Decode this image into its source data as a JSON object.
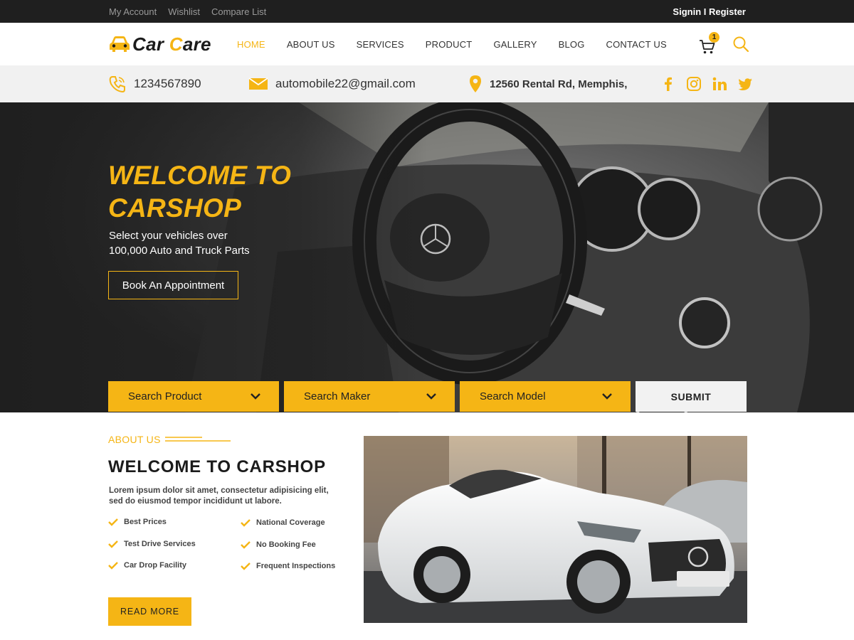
{
  "topbar": {
    "links": [
      "My Account",
      "Wishlist",
      "Compare List"
    ],
    "auth": "Signin I Register"
  },
  "brand": {
    "part1": "Car ",
    "part2_accent": "C",
    "part2": "are"
  },
  "nav": {
    "items": [
      "HOME",
      "ABOUT US",
      "SERVICES",
      "PRODUCT",
      "GALLERY",
      "BLOG",
      "CONTACT US"
    ],
    "active": "HOME",
    "cart_count": "1"
  },
  "contact": {
    "phone": "1234567890",
    "email": "automobile22@gmail.com",
    "address": "12560 Rental Rd, Memphis,",
    "social_icons": [
      "facebook-icon",
      "instagram-icon",
      "linkedin-icon",
      "twitter-icon"
    ]
  },
  "hero": {
    "title_line1": "WELCOME TO",
    "title_line2": "CARSHOP",
    "subtitle_line1": "Select your vehicles over",
    "subtitle_line2": "100,000 Auto and Truck Parts",
    "button": "Book An Appointment"
  },
  "search": {
    "product": "Search Product",
    "maker": "Search Maker",
    "model": "Search Model",
    "submit": "SUBMIT"
  },
  "about": {
    "label": "ABOUT US",
    "title": "WELCOME TO CARSHOP",
    "text_line1": "Lorem ipsum dolor sit amet, consectetur adipisicing elit,",
    "text_line2": "sed do eiusmod tempor incididunt ut labore.",
    "features_left": [
      "Best Prices",
      "Test Drive Services",
      "Car Drop Facility"
    ],
    "features_right": [
      "National Coverage",
      "No Booking Fee",
      "Frequent Inspections"
    ],
    "button": "READ  MORE"
  },
  "colors": {
    "accent": "#f5b515",
    "dark": "#1f1f1f",
    "strip": "#f1f1f1"
  }
}
